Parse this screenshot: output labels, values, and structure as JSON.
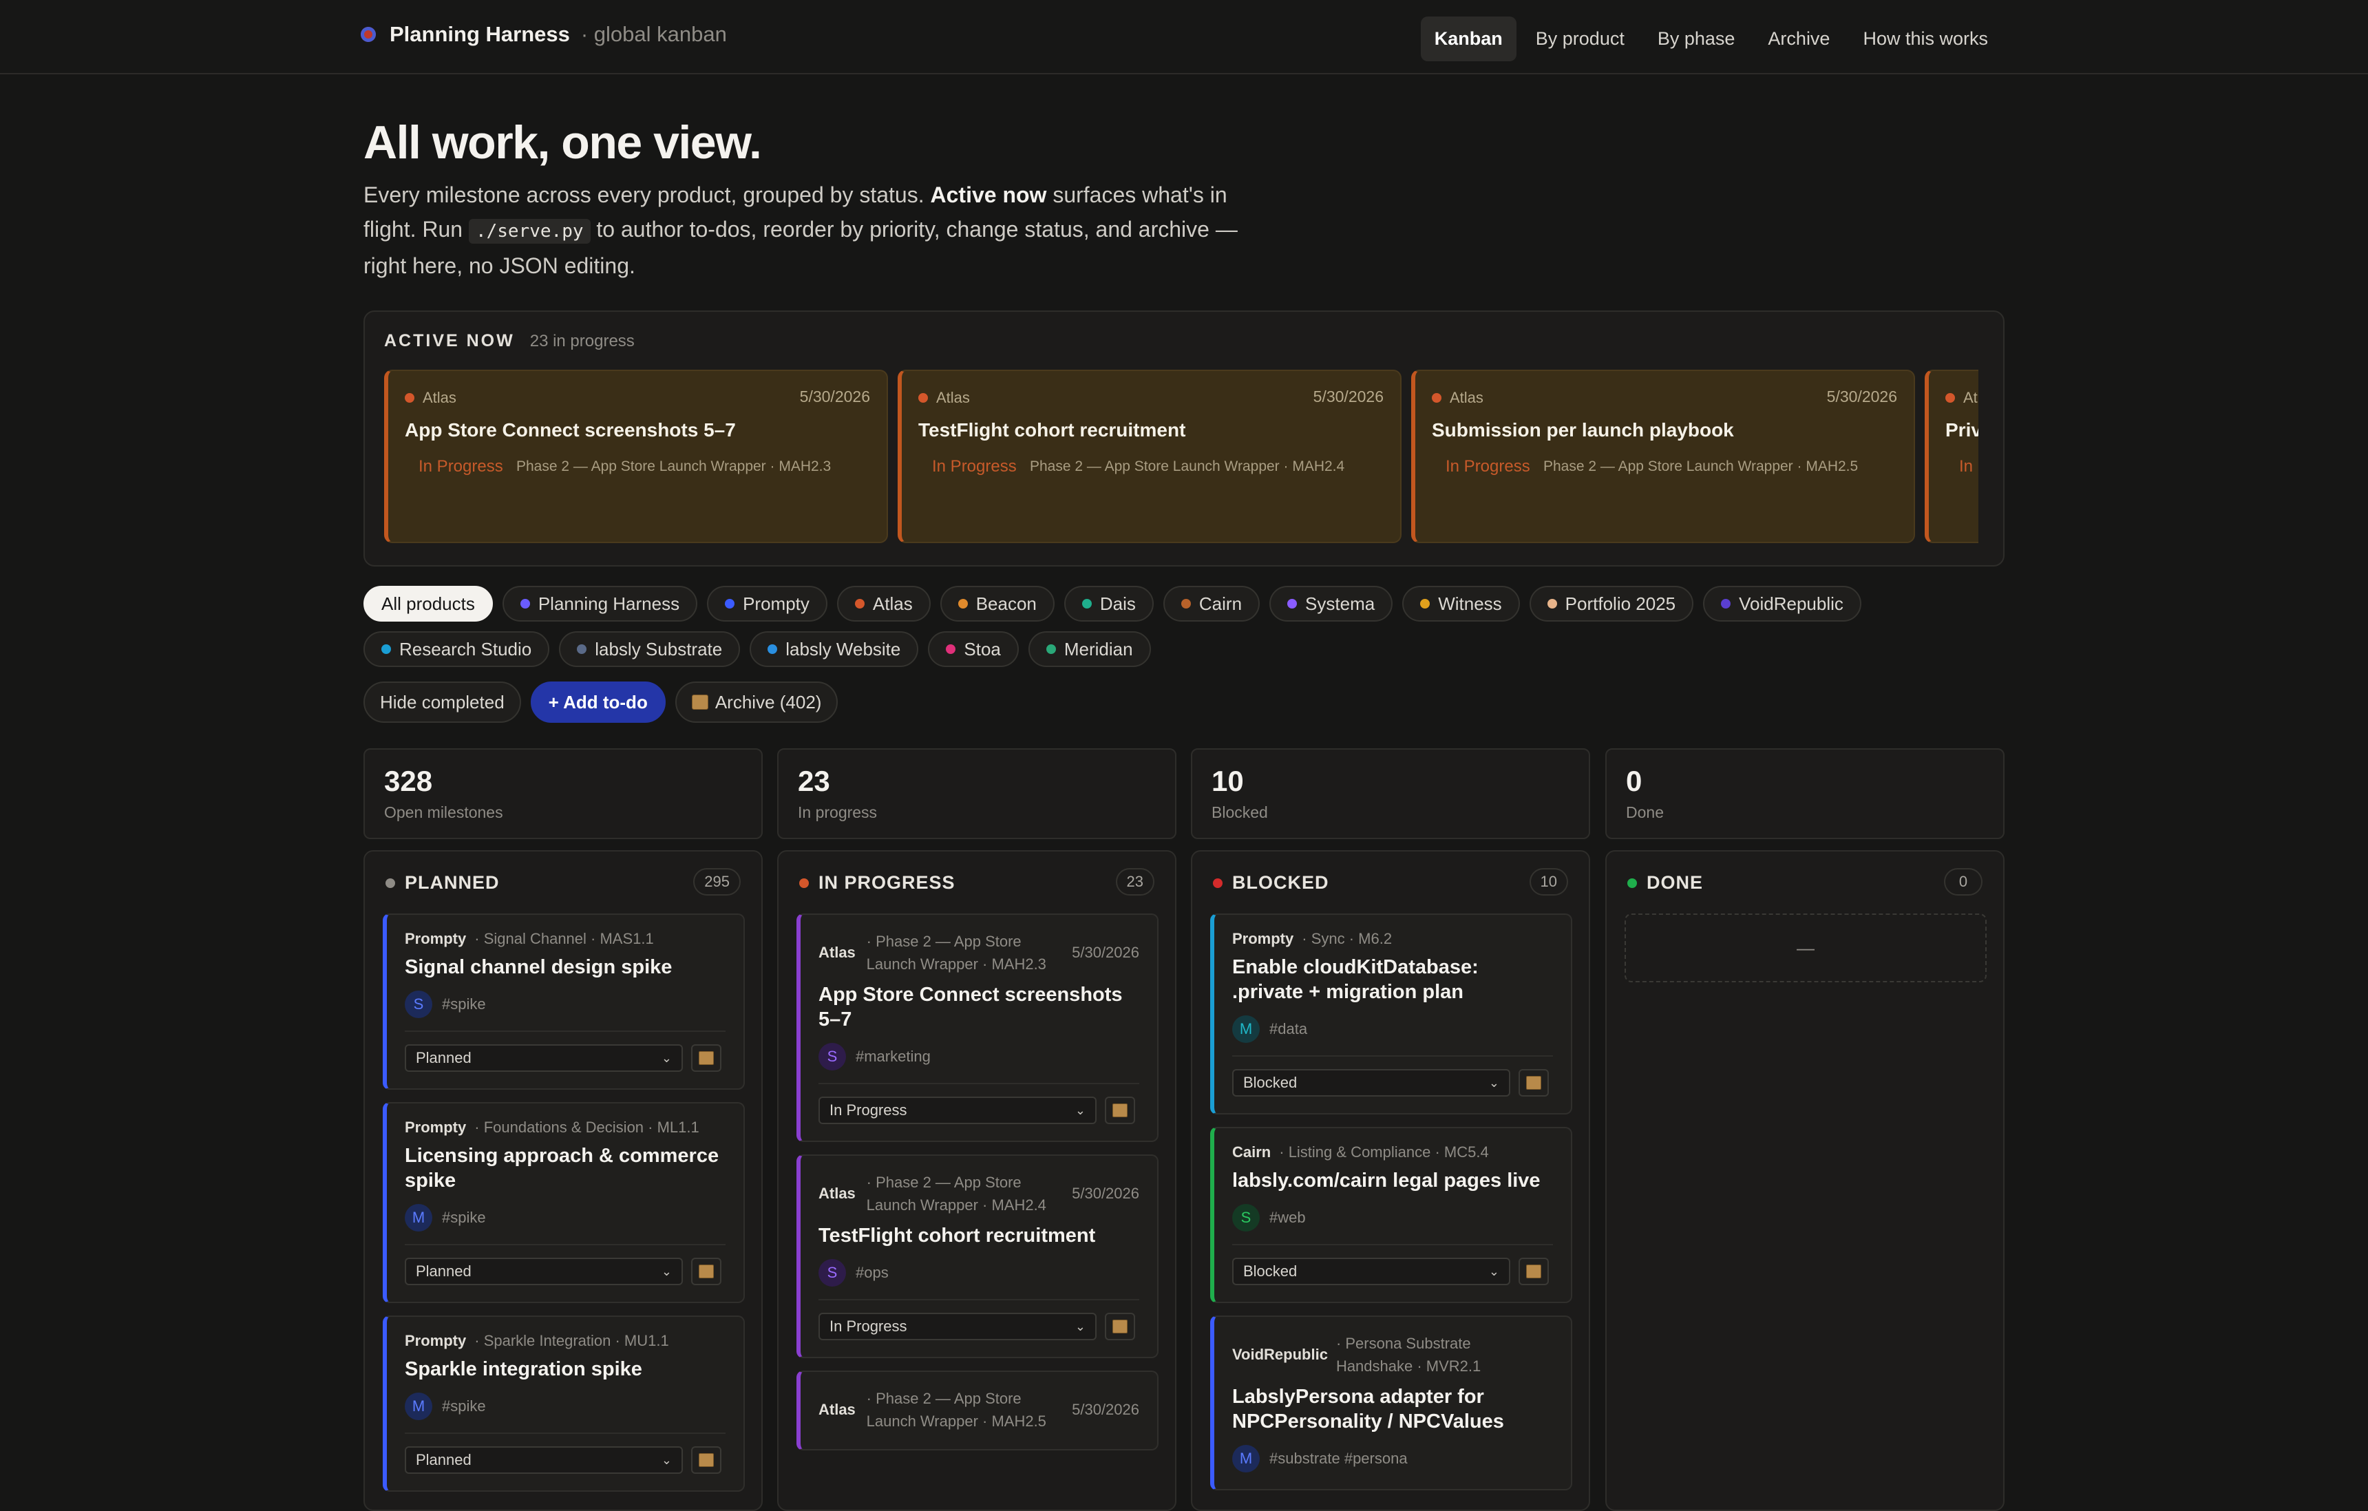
{
  "header": {
    "brand": "Planning Harness",
    "subtitle": "· global kanban",
    "nav": [
      "Kanban",
      "By product",
      "By phase",
      "Archive",
      "How this works"
    ]
  },
  "hero": {
    "title": "All work, one view.",
    "text_1": "Every milestone across every product, grouped by status. ",
    "text_bold": "Active now",
    "text_2": " surfaces what's in flight. Run ",
    "code": "./serve.py",
    "text_3": " to author to-dos, reorder by priority, change status, and archive — right here, no JSON editing."
  },
  "active_now": {
    "label": "ACTIVE NOW",
    "count": "23 in progress",
    "cards": [
      {
        "product": "Atlas",
        "date": "5/30/2026",
        "title": "App Store Connect screenshots 5–7",
        "status": "In Progress",
        "meta": "Phase 2 — App Store Launch Wrapper · MAH2.3"
      },
      {
        "product": "Atlas",
        "date": "5/30/2026",
        "title": "TestFlight cohort recruitment",
        "status": "In Progress",
        "meta": "Phase 2 — App Store Launch Wrapper · MAH2.4"
      },
      {
        "product": "Atlas",
        "date": "5/30/2026",
        "title": "Submission per launch playbook",
        "status": "In Progress",
        "meta": "Phase 2 — App Store Launch Wrapper · MAH2.5"
      },
      {
        "product": "Atlas",
        "date": "",
        "title": "Privacy",
        "status": "In Progress",
        "meta": ""
      }
    ]
  },
  "filters": [
    {
      "label": "All products",
      "color": ""
    },
    {
      "label": "Planning Harness",
      "color": "#6a5cff"
    },
    {
      "label": "Prompty",
      "color": "#3b5bff"
    },
    {
      "label": "Atlas",
      "color": "#d4572b"
    },
    {
      "label": "Beacon",
      "color": "#e08a2c"
    },
    {
      "label": "Dais",
      "color": "#1fae8c"
    },
    {
      "label": "Cairn",
      "color": "#b8622a"
    },
    {
      "label": "Systema",
      "color": "#8a5cff"
    },
    {
      "label": "Witness",
      "color": "#e0a01c"
    },
    {
      "label": "Portfolio 2025",
      "color": "#e8b48a"
    },
    {
      "label": "VoidRepublic",
      "color": "#5a3fd0"
    },
    {
      "label": "Research Studio",
      "color": "#1a9ed4"
    },
    {
      "label": "labsly Substrate",
      "color": "#5a6a88"
    },
    {
      "label": "labsly Website",
      "color": "#2a8fe0"
    },
    {
      "label": "Stoa",
      "color": "#e0307a"
    },
    {
      "label": "Meridian",
      "color": "#2aa878"
    }
  ],
  "actions": {
    "hide_completed": "Hide completed",
    "add_todo": "+ Add to-do",
    "archive": "Archive (402)"
  },
  "stats": [
    {
      "num": "328",
      "label": "Open milestones"
    },
    {
      "num": "23",
      "label": "In progress"
    },
    {
      "num": "10",
      "label": "Blocked"
    },
    {
      "num": "0",
      "label": "Done"
    }
  ],
  "columns": {
    "planned": {
      "title": "PLANNED",
      "count": "295",
      "cards": [
        {
          "product": "Prompty",
          "meta": "· Signal Channel · MAS1.1",
          "title": "Signal channel design spike",
          "avatar": "S",
          "tags": "#spike",
          "status": "Planned",
          "color": "#3b5bff"
        },
        {
          "product": "Prompty",
          "meta": "· Foundations & Decision · ML1.1",
          "title": "Licensing approach & commerce spike",
          "avatar": "M",
          "tags": "#spike",
          "status": "Planned",
          "color": "#3b5bff"
        },
        {
          "product": "Prompty",
          "meta": "· Sparkle Integration · MU1.1",
          "title": "Sparkle integration spike",
          "avatar": "M",
          "tags": "#spike",
          "status": "Planned",
          "color": "#3b5bff"
        }
      ]
    },
    "in_progress": {
      "title": "IN PROGRESS",
      "count": "23",
      "cards": [
        {
          "product": "Atlas",
          "meta": "· Phase 2 — App Store Launch Wrapper · MAH2.3",
          "date": "5/30/2026",
          "title": "App Store Connect screenshots 5–7",
          "avatar": "S",
          "tags": "#marketing",
          "status": "In Progress"
        },
        {
          "product": "Atlas",
          "meta": "· Phase 2 — App Store Launch Wrapper · MAH2.4",
          "date": "5/30/2026",
          "title": "TestFlight cohort recruitment",
          "avatar": "S",
          "tags": "#ops",
          "status": "In Progress"
        },
        {
          "product": "Atlas",
          "meta": "· Phase 2 — App Store Launch Wrapper · MAH2.5",
          "date": "5/30/2026",
          "title": "",
          "avatar": "",
          "tags": "",
          "status": ""
        }
      ]
    },
    "blocked": {
      "title": "BLOCKED",
      "count": "10",
      "cards": [
        {
          "product": "Prompty",
          "meta": "· Sync · M6.2",
          "title": "Enable cloudKitDatabase: .private + migration plan",
          "avatar": "M",
          "tags": "#data",
          "status": "Blocked",
          "color": "#1a9ed4"
        },
        {
          "product": "Cairn",
          "meta": "· Listing & Compliance · MC5.4",
          "title": "labsly.com/cairn legal pages live",
          "avatar": "S",
          "tags": "#web",
          "status": "Blocked",
          "color": "#1fae4c"
        },
        {
          "product": "VoidRepublic",
          "meta": "· Persona Substrate Handshake · MVR2.1",
          "title": "LabslyPersona adapter for NPCPersonality / NPCValues",
          "avatar": "M",
          "tags": "#substrate  #persona",
          "status": "",
          "color": "#3b5bff"
        }
      ]
    },
    "done": {
      "title": "DONE",
      "count": "0",
      "empty": "—"
    }
  }
}
